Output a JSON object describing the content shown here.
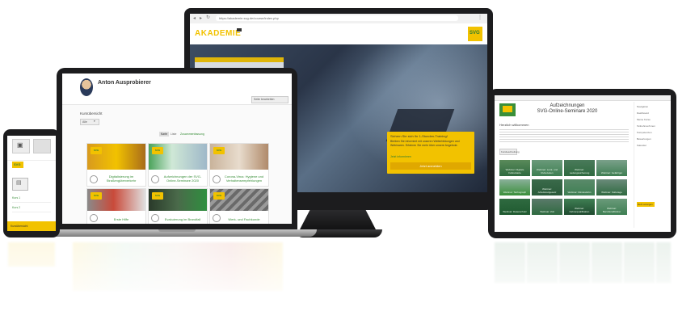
{
  "monitor": {
    "url": "https://akademie.svg.de/course/index.php",
    "logo_text": "AKADEMIE",
    "brand": "SVG",
    "promo_title": "Sichern Sie sich Ihr 1-Stunden-Training!",
    "promo_body": "Bleiben Sie informiert mit unseren Weiterbildungen und Webinaren. Erfahren Sie mehr über unsere Angebote.",
    "promo_link": "Jetzt informieren",
    "promo_button": "Jetzt anmelden"
  },
  "laptop": {
    "user_name": "Anton Ausprobierer",
    "dashboard_button": "Seite bearbeiten",
    "section_heading": "Kursübersicht",
    "filter_value": "Alle",
    "view_tabs": [
      "Karte",
      "Liste",
      "Zusammenfassung"
    ],
    "badge": "SVG",
    "courses": [
      {
        "title": "Digitalisierung im Straßengüterverkehr",
        "tone": "#e7b33a"
      },
      {
        "title": "Aufzeichnungen der SVG-Online-Seminare 2020",
        "tone": "#8fc9a0"
      },
      {
        "title": "Corona-Virus: Hygiene und Verhaltensempfehlungen",
        "tone": "#c9a98f"
      },
      {
        "title": "Erste Hilfe",
        "tone": "#c94a3a"
      },
      {
        "title": "Evakuierung im Brandfall",
        "tone": "#5a7a5a"
      },
      {
        "title": "Werk- und Fachkunde",
        "tone": "#8a8a8a"
      }
    ]
  },
  "tablet": {
    "title_line1": "Aufzeichnungen",
    "title_line2": "SVG-Online-Seminare 2020",
    "welcome": "Herzlich willkommen",
    "button": "Kursbeschreibung",
    "sidebar_items": [
      "Navigation",
      "Dashboard",
      "Meine Kurse",
      "Teilnehmer/innen",
      "Kompetenzen",
      "Bewertungen",
      "Kalender"
    ],
    "sidebar_button": "Mehr anzeigen",
    "tiles": [
      "Webinar: Digitale Fahrerkarte",
      "Webinar: Lenk- und Ruhezeiten",
      "Webinar: Ladungssicherung",
      "Webinar: Gefahrgut",
      "Webinar: Tachograph",
      "Webinar: Arbeitszeitgesetz",
      "Webinar: Mindestlohn",
      "Webinar: Kabotage",
      "Webinar: Datenschutz",
      "Webinar: Zoll",
      "Webinar: Fahrerqualifikation",
      "Webinar: Berufskraftfahrer"
    ]
  },
  "phone": {
    "badge": "SVG",
    "items": [
      "Kurs 1",
      "Kurs 2"
    ],
    "footer": "Kursübersicht"
  },
  "colors": {
    "brand_green": "#3a8f3a",
    "brand_yellow": "#f2c200",
    "bezel": "#1c1c1e"
  }
}
